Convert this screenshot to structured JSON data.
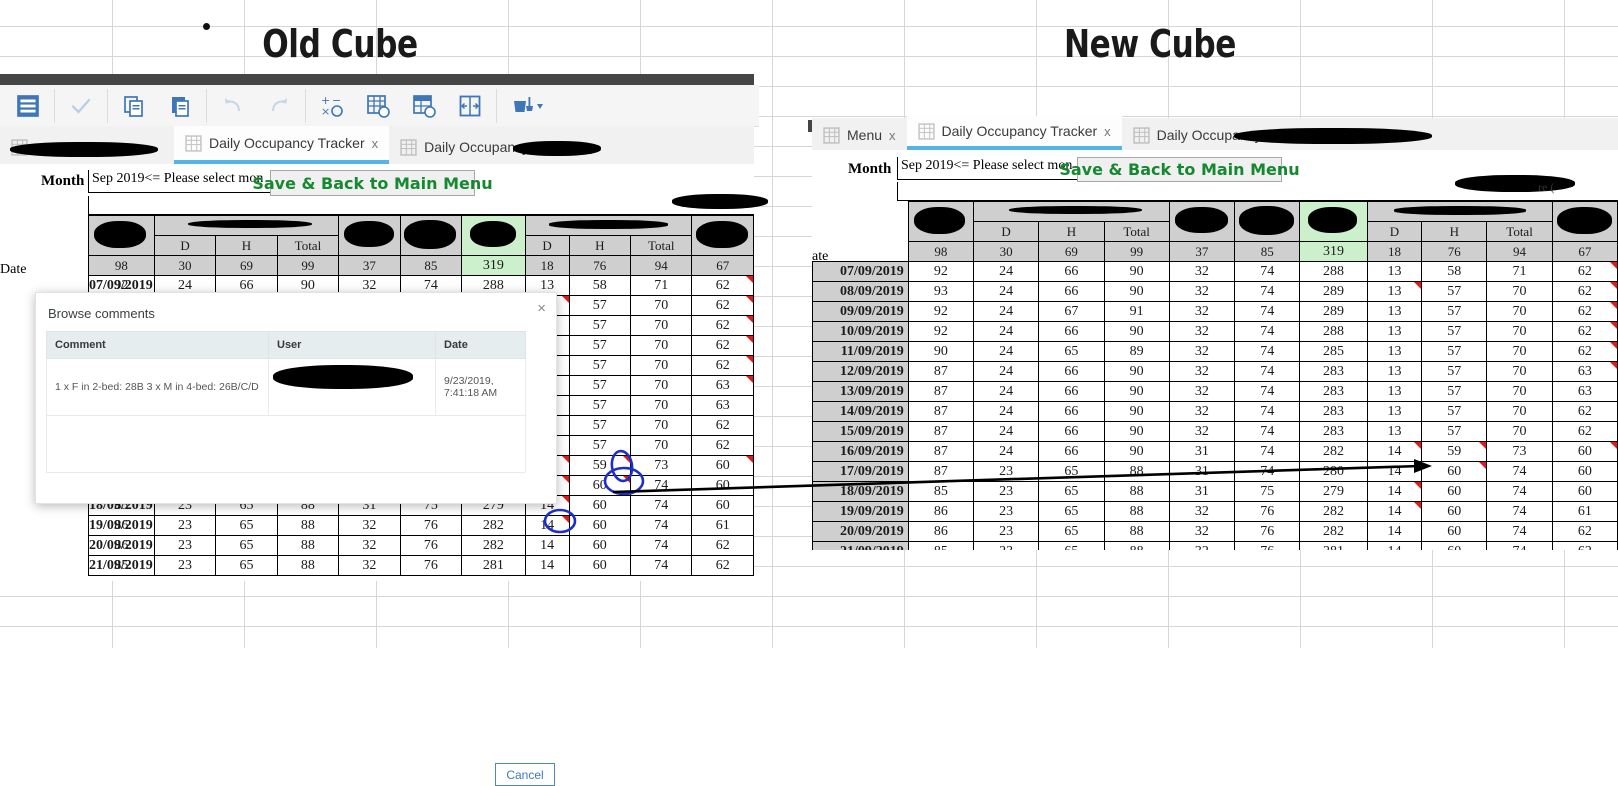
{
  "titles": {
    "old": "Old Cube",
    "new": "New Cube"
  },
  "toolbar": {
    "icons": [
      {
        "name": "menu-icon",
        "label": "Menu"
      },
      {
        "name": "check-icon",
        "label": "Commit"
      },
      {
        "name": "copy-icon",
        "label": "Copy"
      },
      {
        "name": "paste-icon",
        "label": "Paste"
      },
      {
        "name": "undo-icon",
        "label": "Undo"
      },
      {
        "name": "redo-icon",
        "label": "Redo"
      },
      {
        "name": "calculate-icon",
        "label": "Recalculate"
      },
      {
        "name": "recalc-sheet-icon",
        "label": "Recalculate sheet"
      },
      {
        "name": "recalc-book-icon",
        "label": "Recalculate workbook"
      },
      {
        "name": "fit-width-icon",
        "label": "Fit width"
      },
      {
        "name": "format-paint-icon",
        "label": "Format"
      }
    ]
  },
  "old_cube": {
    "tabs": [
      {
        "label": "",
        "redacted": true,
        "active": false,
        "close": ""
      },
      {
        "label": "Daily Occupancy Tracker",
        "redacted": false,
        "active": true,
        "close": "x"
      },
      {
        "label": "Daily Occupancy Track",
        "redacted": true,
        "active": false,
        "close": "x"
      }
    ],
    "month_label": "Month",
    "month_value": "Sep 2019",
    "month_hint": "<= Please select mon",
    "save_button": "Save & Back to Main Menu",
    "row_header": "Date"
  },
  "new_cube": {
    "tabs": [
      {
        "label": "Menu",
        "redacted": false,
        "active": false,
        "close": "x"
      },
      {
        "label": "Daily Occupancy Tracker",
        "redacted": false,
        "active": true,
        "close": "x"
      },
      {
        "label": "Daily Occupancy",
        "redacted": true,
        "active": false,
        "close": ""
      }
    ],
    "month_label": "Month",
    "month_value": "Sep 2019",
    "month_hint": "<= Please select mon",
    "save_button": "Save & Back to Main Menu",
    "row_header": "ate",
    "right_fragment": "re ("
  },
  "table": {
    "sub_headers": [
      "",
      "D",
      "H",
      "Total",
      "",
      "",
      "",
      "D",
      "H",
      "Total",
      ""
    ],
    "totals_row": [
      "98",
      "30",
      "69",
      "99",
      "37",
      "85",
      "319",
      "18",
      "76",
      "94",
      "67"
    ],
    "rows": [
      {
        "date": "07/09/2019",
        "values": [
          "92",
          "24",
          "66",
          "90",
          "32",
          "74",
          "288",
          "13",
          "58",
          "71",
          "62"
        ],
        "marks": [
          0,
          0,
          0,
          0,
          0,
          0,
          0,
          0,
          0,
          0,
          1
        ]
      },
      {
        "date": "08/09/2019",
        "values": [
          "93",
          "24",
          "66",
          "90",
          "32",
          "74",
          "289",
          "13",
          "57",
          "70",
          "62"
        ],
        "marks": [
          0,
          0,
          0,
          0,
          0,
          0,
          0,
          1,
          0,
          0,
          1
        ]
      },
      {
        "date": "09/09/2019",
        "values": [
          "92",
          "24",
          "67",
          "91",
          "32",
          "74",
          "289",
          "13",
          "57",
          "70",
          "62"
        ],
        "marks": [
          0,
          0,
          0,
          0,
          0,
          0,
          0,
          0,
          0,
          0,
          1
        ]
      },
      {
        "date": "10/09/2019",
        "values": [
          "92",
          "24",
          "66",
          "90",
          "32",
          "74",
          "288",
          "13",
          "57",
          "70",
          "62"
        ],
        "marks": [
          0,
          0,
          0,
          0,
          0,
          0,
          0,
          0,
          0,
          0,
          1
        ]
      },
      {
        "date": "11/09/2019",
        "values": [
          "90",
          "24",
          "65",
          "89",
          "32",
          "74",
          "285",
          "13",
          "57",
          "70",
          "62"
        ],
        "marks": [
          0,
          0,
          0,
          0,
          0,
          0,
          0,
          0,
          0,
          0,
          1
        ]
      },
      {
        "date": "12/09/2019",
        "values": [
          "87",
          "24",
          "66",
          "90",
          "32",
          "74",
          "283",
          "13",
          "57",
          "70",
          "63"
        ],
        "marks": [
          0,
          0,
          0,
          0,
          0,
          0,
          0,
          0,
          0,
          0,
          1
        ]
      },
      {
        "date": "13/09/2019",
        "values": [
          "87",
          "24",
          "66",
          "90",
          "32",
          "74",
          "283",
          "13",
          "57",
          "70",
          "63"
        ],
        "marks": [
          0,
          0,
          0,
          0,
          0,
          0,
          0,
          0,
          0,
          0,
          0
        ]
      },
      {
        "date": "14/09/2019",
        "values": [
          "87",
          "24",
          "66",
          "90",
          "32",
          "74",
          "283",
          "13",
          "57",
          "70",
          "62"
        ],
        "marks": [
          0,
          0,
          0,
          0,
          0,
          0,
          0,
          0,
          0,
          0,
          0
        ]
      },
      {
        "date": "15/09/2019",
        "values": [
          "87",
          "24",
          "66",
          "90",
          "32",
          "74",
          "283",
          "13",
          "57",
          "70",
          "62"
        ],
        "marks": [
          0,
          0,
          0,
          0,
          0,
          0,
          0,
          0,
          0,
          0,
          0
        ]
      },
      {
        "date": "16/09/2019",
        "values": [
          "87",
          "24",
          "66",
          "90",
          "31",
          "74",
          "282",
          "14",
          "59",
          "73",
          "60"
        ],
        "marks": [
          0,
          0,
          0,
          0,
          0,
          0,
          0,
          1,
          1,
          0,
          1
        ]
      },
      {
        "date": "17/09/2019",
        "values": [
          "87",
          "23",
          "65",
          "88",
          "31",
          "74",
          "280",
          "14",
          "60",
          "74",
          "60"
        ],
        "marks": [
          0,
          0,
          0,
          0,
          0,
          0,
          0,
          1,
          1,
          0,
          0
        ]
      },
      {
        "date": "18/09/2019",
        "values": [
          "85",
          "23",
          "65",
          "88",
          "31",
          "75",
          "279",
          "14",
          "60",
          "74",
          "60"
        ],
        "marks": [
          0,
          0,
          0,
          0,
          0,
          0,
          0,
          1,
          0,
          0,
          0
        ]
      },
      {
        "date": "19/09/2019",
        "values": [
          "86",
          "23",
          "65",
          "88",
          "32",
          "76",
          "282",
          "14",
          "60",
          "74",
          "61"
        ],
        "marks": [
          0,
          0,
          0,
          0,
          0,
          0,
          0,
          1,
          0,
          0,
          0
        ]
      },
      {
        "date": "20/09/2019",
        "values": [
          "86",
          "23",
          "65",
          "88",
          "32",
          "76",
          "282",
          "14",
          "60",
          "74",
          "62"
        ],
        "marks": [
          0,
          0,
          0,
          0,
          0,
          0,
          0,
          0,
          0,
          0,
          0
        ]
      },
      {
        "date": "21/09/2019",
        "values": [
          "85",
          "23",
          "65",
          "88",
          "32",
          "76",
          "281",
          "14",
          "60",
          "74",
          "62"
        ],
        "marks": [
          0,
          0,
          0,
          0,
          0,
          0,
          0,
          0,
          0,
          0,
          0
        ]
      }
    ]
  },
  "dialog": {
    "title": "Browse comments",
    "close_icon": "×",
    "columns": [
      "Comment",
      "User",
      "Date"
    ],
    "rows": [
      {
        "comment": "1 x F in 2-bed: 28B 3 x M in 4-bed: 26B/C/D",
        "user": "",
        "date": "9/23/2019, 7:41:18 AM"
      }
    ],
    "cancel_label": "Cancel"
  },
  "colors": {
    "accent_blue": "#4a7ebb",
    "tab_active_underline": "#56b3e8",
    "green_cell": "#ccf0cc",
    "save_text": "#15892f",
    "comment_marker": "#e01b1b",
    "annotation_blue": "#1d2fc9",
    "header_gray": "#cfcfcf"
  }
}
